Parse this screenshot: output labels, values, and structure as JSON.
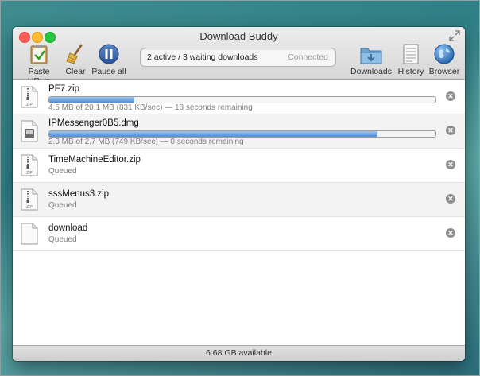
{
  "window": {
    "title": "Download Buddy"
  },
  "toolbar": {
    "paste_label": "Paste URL's",
    "clear_label": "Clear",
    "pause_label": "Pause all",
    "downloads_label": "Downloads",
    "history_label": "History",
    "browser_label": "Browser",
    "status_text": "2 active / 3 waiting downloads",
    "connection_text": "Connected"
  },
  "downloads": [
    {
      "name": "PF7.zip",
      "info": "4.5 MB of 20.1 MB (831 KB/sec) — 18 seconds remaining",
      "progress": 0.22,
      "icon": "zip-file-icon"
    },
    {
      "name": "IPMessenger0B5.dmg",
      "info": "2.3 MB of 2.7 MB (749 KB/sec) — 0 seconds remaining",
      "progress": 0.85,
      "icon": "dmg-file-icon"
    },
    {
      "name": "TimeMachineEditor.zip",
      "info": "Queued",
      "icon": "zip-file-icon"
    },
    {
      "name": "sssMenus3.zip",
      "info": "Queued",
      "icon": "zip-file-icon"
    },
    {
      "name": "download",
      "info": "Queued",
      "icon": "generic-file-icon"
    }
  ],
  "footer": {
    "available_text": "6.68 GB available"
  }
}
